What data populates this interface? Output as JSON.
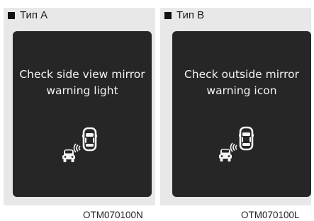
{
  "panels": [
    {
      "title": "Тип A",
      "message": "Check side view mirror\nwarning light",
      "code": "OTM070100N",
      "icon": "blind-spot-warning-icon"
    },
    {
      "title": "Тип B",
      "message": "Check outside mirror\nwarning icon",
      "code": "OTM070100L",
      "icon": "blind-spot-warning-icon"
    }
  ],
  "colors": {
    "panel_background": "#e8e8e8",
    "screen_background": "#262626",
    "screen_text": "#f4f4f4",
    "icon_color": "#f4f4f4"
  }
}
